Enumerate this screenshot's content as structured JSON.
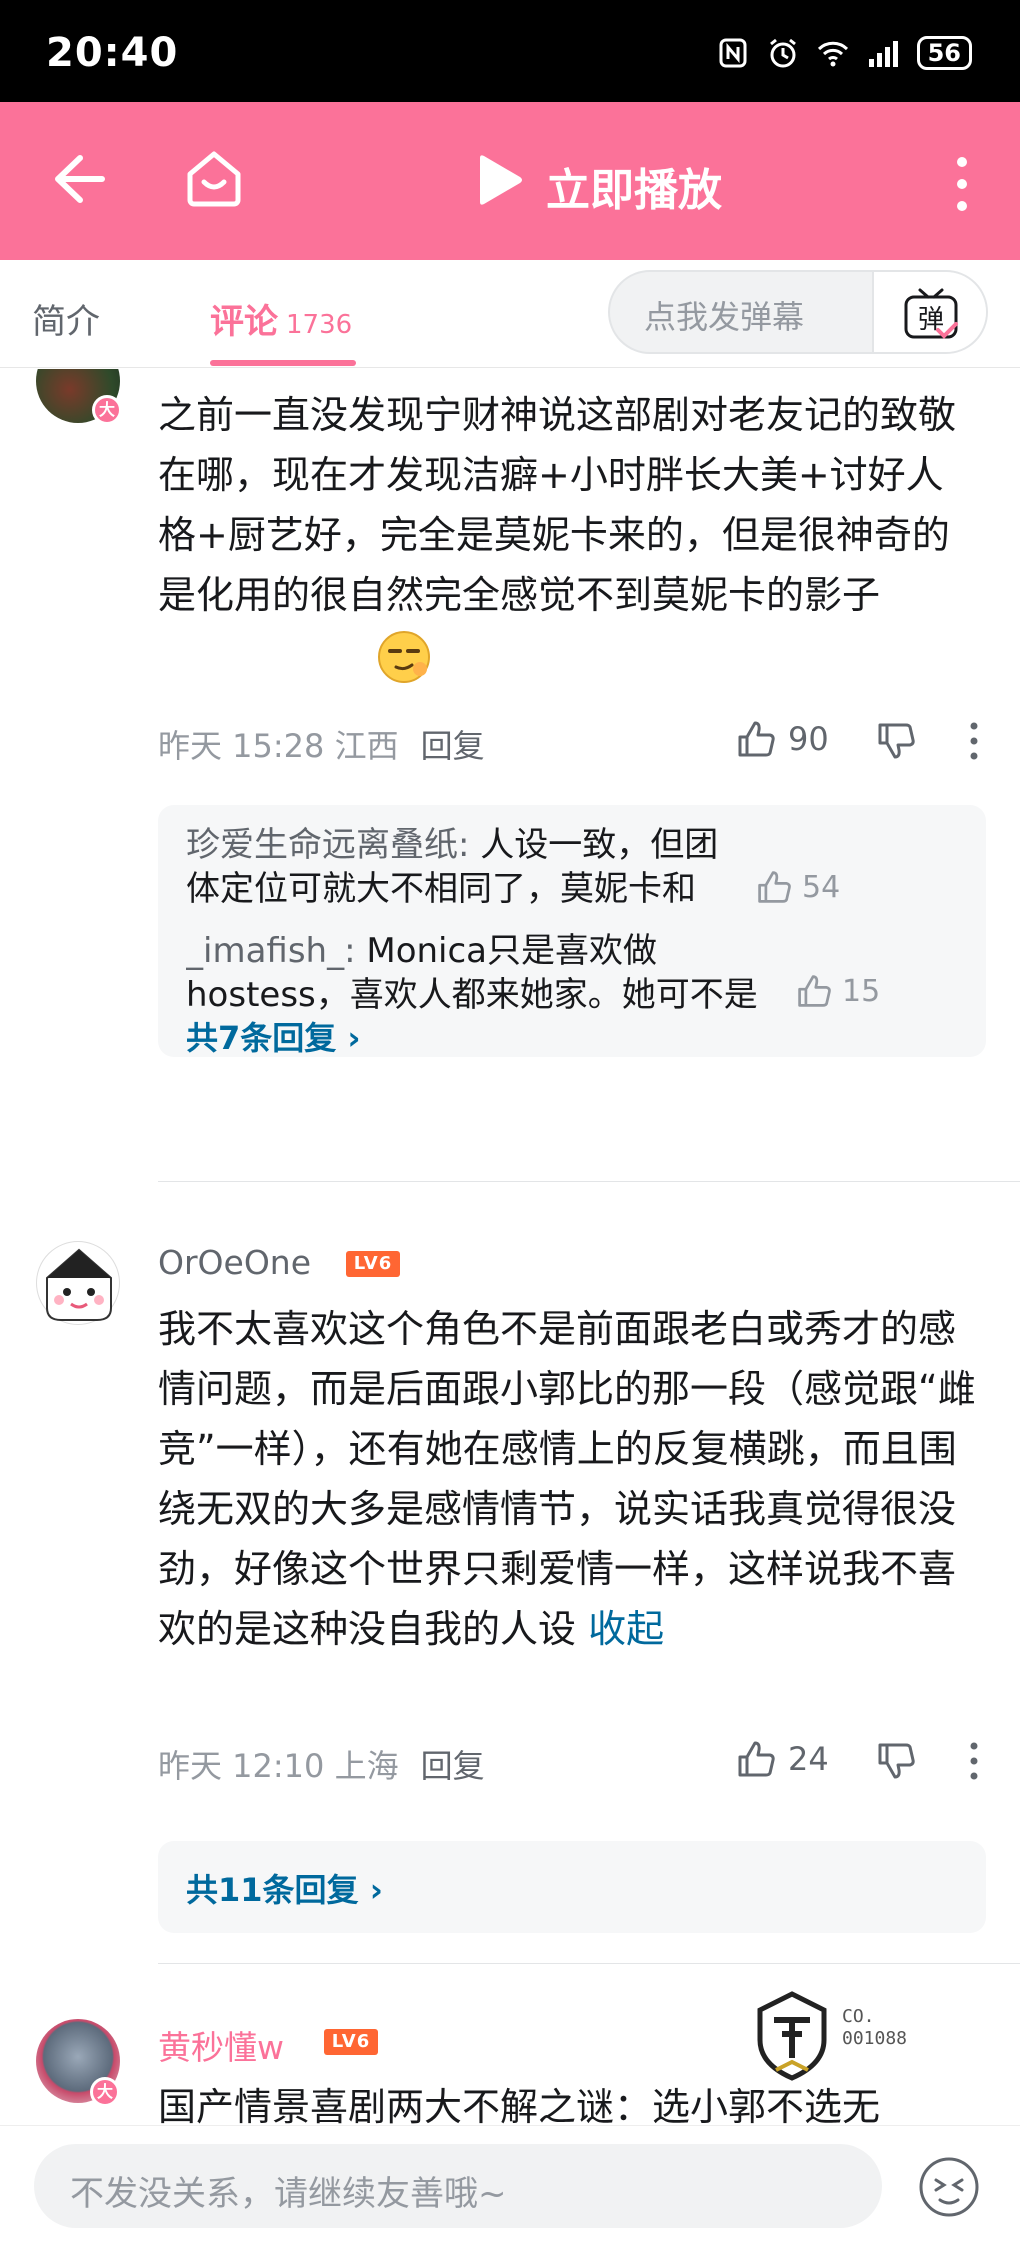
{
  "status_bar": {
    "time": "20:40",
    "battery": "56"
  },
  "top_bar": {
    "play_label": "立即播放"
  },
  "tabs": {
    "intro": "简介",
    "comments": "评论",
    "comment_count": "1736",
    "danmaku_placeholder": "点我发弹幕",
    "danmaku_button_glyph": "弹"
  },
  "colors": {
    "brand_pink": "#fb7299",
    "link_blue": "#00699d",
    "level_orange": "#ff6633"
  },
  "comments": [
    {
      "text": "之前一直没发现宁财神说这部剧对老友记的致敬在哪，现在才发现洁癖+小时胖长大美+讨好人格+厨艺好，完全是莫妮卡来的，但是很神奇的是化用的很自然完全感觉不到莫妮卡的影子",
      "avatar_badge": "大",
      "meta": "昨天 15:28 江西",
      "reply_label": "回复",
      "likes": "90",
      "replies": [
        {
          "user": "珍爱生命远离叠纸",
          "text": "人设一致，但团体定位可就大不相同了，莫妮卡和ross...",
          "likes": "54"
        },
        {
          "user": "_imafish_",
          "text": "Monica只是喜欢做hostess，喜欢人都来她家。她可不是讨好型人...",
          "likes": "15"
        }
      ],
      "more_replies": "共7条回复"
    },
    {
      "user": "OrOeOne",
      "level": "LV6",
      "text": "我不太喜欢这个角色不是前面跟老白或秀才的感情问题，而是后面跟小郭比的那一段（感觉跟“雌竞”一样），还有她在感情上的反复横跳，而且围绕无双的大多是感情情节，说实话我真觉得很没劲，好像这个世界只剩爱情一样，这样说我不喜欢的是这种没自我的人设",
      "collapse": "收起",
      "meta": "昨天 12:10 上海",
      "reply_label": "回复",
      "likes": "24",
      "more_replies": "共11条回复"
    },
    {
      "user": "黄秒懂w",
      "level": "LV6",
      "avatar_badge": "大",
      "text": "国产情景喜剧两大不解之谜：选小郭不选无"
    }
  ],
  "watermark": {
    "line1": "CO.",
    "line2": "001088"
  },
  "bottom_bar": {
    "placeholder": "不发没关系，请继续友善哦~"
  }
}
